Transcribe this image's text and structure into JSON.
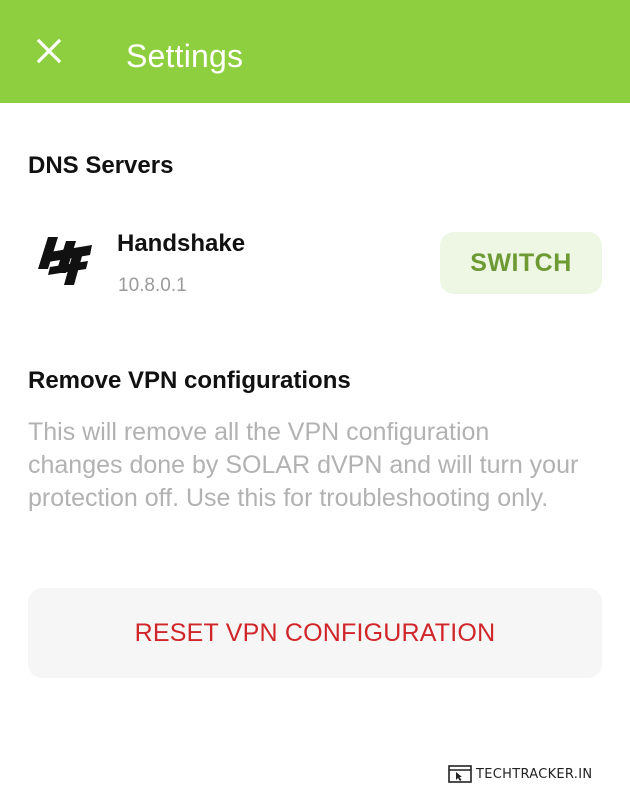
{
  "app_bar": {
    "title": "Settings",
    "close_icon": "close-icon",
    "background": "#8ecf3f"
  },
  "dns": {
    "section_title": "DNS Servers",
    "server": {
      "name": "Handshake",
      "address": "10.8.0.1",
      "logo_icon": "handshake-logo"
    },
    "switch_label": "SWITCH"
  },
  "remove_vpn": {
    "section_title": "Remove VPN configurations",
    "description": "This will remove all the VPN configuration changes done by SOLAR dVPN and will turn your protection off. Use this for troubleshooting only.",
    "reset_label": "RESET VPN CONFIGURATION"
  },
  "watermark": {
    "text": "TECHTRACKER.IN",
    "icon": "browser-cursor-icon"
  },
  "colors": {
    "accent_green": "#8ecf3f",
    "switch_text": "#6e9a34",
    "switch_bg": "#edf7e3",
    "danger_red": "#d0262a",
    "muted_text": "#b2b2b2"
  }
}
